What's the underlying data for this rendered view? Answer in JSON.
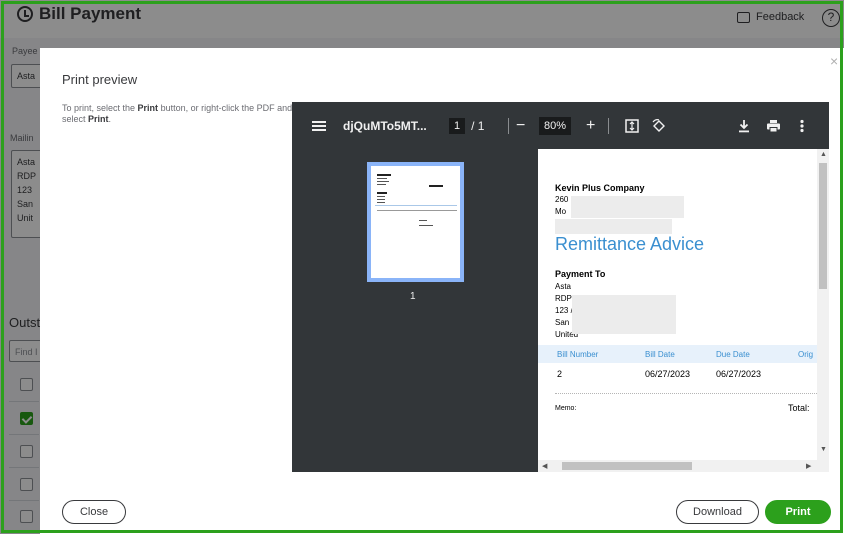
{
  "app": {
    "title": "Bill Payment",
    "feedback_label": "Feedback",
    "help_label": "?",
    "payee_label": "Payee",
    "payee_value": "Asta",
    "mailing_label": "Mailin",
    "mailing_lines": [
      "Asta",
      "RDP",
      "123",
      "San",
      "Unit"
    ],
    "outstanding_heading": "Outst",
    "find_placeholder": "Find I"
  },
  "dialog": {
    "title": "Print preview",
    "hint_prefix": "To print, select the ",
    "hint_print_bold": "Print",
    "hint_middle": " button, or right-click the PDF and select ",
    "hint_print_bold_2": "Print",
    "hint_suffix": ".",
    "close_x": "×",
    "close_button": "Close",
    "download_button": "Download",
    "print_button": "Print"
  },
  "viewer": {
    "filename": "djQuMTo5MT...",
    "page_current": "1",
    "page_total": "/ 1",
    "zoom": "80%",
    "zoom_out": "−",
    "zoom_in": "+",
    "thumbnail_page": "1",
    "document": {
      "company": "Kevin Plus Company",
      "company_addr_1": "260",
      "company_addr_2": "Mo",
      "heading": "Remittance Advice",
      "payment_to_label": "Payment To",
      "payee_lines": [
        "Asta",
        "RDP In",
        "123 /",
        "San I",
        "United"
      ],
      "columns": [
        "Bill Number",
        "Bill Date",
        "Due Date",
        "Orig"
      ],
      "row": [
        "2",
        "06/27/2023",
        "06/27/2023"
      ],
      "memo_label": "Memo:",
      "total_label": "Total:"
    }
  },
  "colors": {
    "brand_green": "#2ca01c",
    "heading_blue": "#3a8fd0",
    "viewer_toolbar": "#323639"
  }
}
